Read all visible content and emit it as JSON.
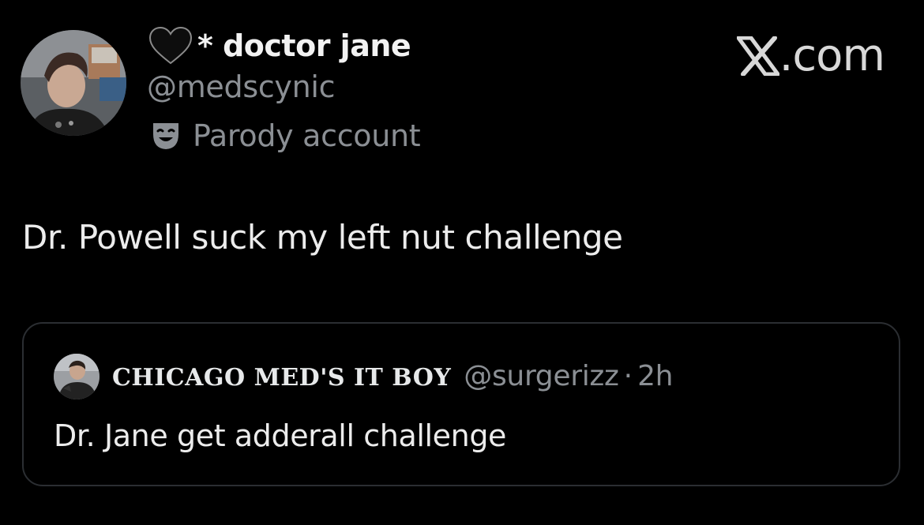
{
  "author": {
    "display_name": "* doctor jane",
    "handle": "@medscynic",
    "label": "Parody account",
    "avatar_icon": "profile-photo",
    "name_emoji": "black-heart-icon",
    "label_icon": "theater-mask-icon"
  },
  "brand": {
    "text": ".com",
    "logo_icon": "x-logo-icon"
  },
  "tweet": {
    "text": "Dr. Powell suck my left nut challenge"
  },
  "quoted": {
    "display_name": "CHICAGO MED'S IT BOY",
    "handle": "@surgerizz",
    "separator": "·",
    "time": "2h",
    "text": "Dr. Jane get adderall challenge",
    "avatar_icon": "profile-photo"
  },
  "colors": {
    "background": "#000000",
    "primary_text": "#e7e9ea",
    "secondary_text": "#8b8f94",
    "card_border": "#2b2e32"
  }
}
